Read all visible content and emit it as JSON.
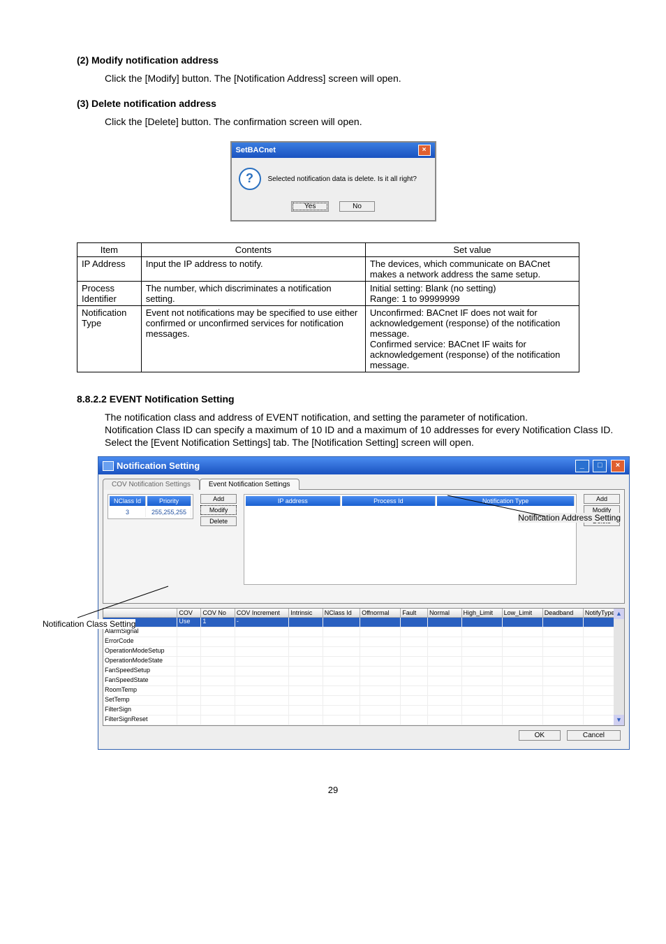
{
  "sections": {
    "h1": "(2) Modify notification address",
    "p1": "Click the [Modify] button. The [Notification Address] screen will open.",
    "h2": "(3) Delete notification address",
    "p2": "Click the [Delete] button. The confirmation screen will open.",
    "h3": "8.8.2.2 EVENT Notification Setting",
    "p3a": "The notification class and address of EVENT notification, and setting the parameter of notification.",
    "p3b": "Notification Class ID can specify a maximum of 10 ID and a maximum of 10 addresses for every Notification Class ID.",
    "p3c": "Select the [Event Notification Settings] tab. The [Notification Setting] screen will open."
  },
  "confirm_dialog": {
    "title": "SetBACnet",
    "message": "Selected notification data is delete. Is it all right?",
    "yes": "Yes",
    "no": "No"
  },
  "spec_table": {
    "headers": [
      "Item",
      "Contents",
      "Set value"
    ],
    "rows": [
      {
        "item": "IP Address",
        "contents": "Input the IP address to notify.",
        "setvalue": "The devices, which communicate on BACnet makes a network address the same setup."
      },
      {
        "item": "Process Identifier",
        "contents": "The number, which discriminates a notification setting.",
        "setvalue": "Initial setting: Blank (no setting)\nRange: 1 to 99999999"
      },
      {
        "item": "Notification Type",
        "contents": "Event not notifications may be specified to use either confirmed or unconfirmed services for notification messages.",
        "setvalue": "Unconfirmed: BACnet IF does not wait for acknowledgement (response) of the notification message.\nConfirmed service: BACnet IF waits for acknowledgement (response) of the notification message."
      }
    ]
  },
  "notif_window": {
    "title": "Notification Setting",
    "tab_inactive": "COV Notification Settings",
    "tab_active": "Event Notification Settings",
    "left_headers": [
      "NClass Id",
      "Priority"
    ],
    "left_row": [
      "3",
      "255,255,255"
    ],
    "btn_add": "Add",
    "btn_modify": "Modify",
    "btn_delete": "Delete",
    "right_headers": [
      "IP address",
      "Process Id",
      "Notification Type"
    ],
    "lower_headers": [
      "",
      "COV",
      "COV No",
      "COV Increment",
      "Intrinsic",
      "NClass Id",
      "Offnormal",
      "Fault",
      "Normal",
      "High_Limit",
      "Low_Limit",
      "Deadband",
      "NotifyType"
    ],
    "lower_sel_row": [
      "",
      "Use",
      "1",
      "-",
      "",
      "",
      "",
      "",
      "",
      "",
      "",
      "",
      ""
    ],
    "lower_rows": [
      "AlarmSignal",
      "ErrorCode",
      "OperationModeSetup",
      "OperationModeState",
      "FanSpeedSetup",
      "FanSpeedState",
      "RoomTemp",
      "SetTemp",
      "FilterSign",
      "FilterSignReset"
    ],
    "ok": "OK",
    "cancel": "Cancel"
  },
  "callouts": {
    "right": "Notification Address Setting",
    "left": "Notification Class Setting"
  },
  "page_number": "29"
}
